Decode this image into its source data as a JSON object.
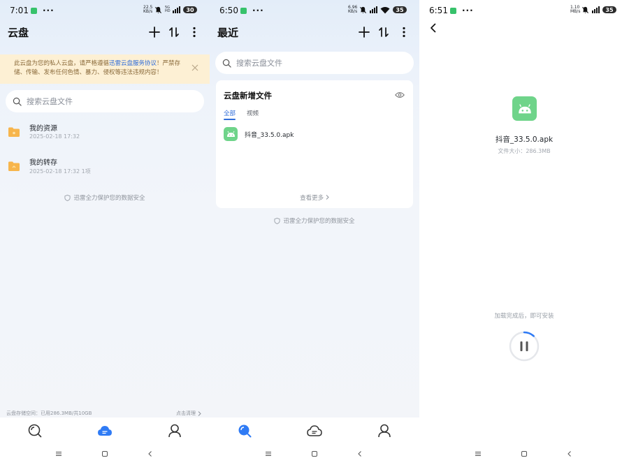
{
  "panel1": {
    "status": {
      "time": "7:01",
      "dots": "···",
      "speed": "22.5 KB/s",
      "network": "5G HD",
      "battery": "30"
    },
    "header": {
      "title": "云盘"
    },
    "notice": {
      "text_before": "此云盘为您的私人云盘，请严格遵循",
      "link": "迅雷云盘服务协议",
      "text_after": "！严禁存储、传输、发布任何色情、暴力、侵权等违法违规内容！"
    },
    "search": {
      "placeholder": "搜索云盘文件"
    },
    "folders": [
      {
        "name": "我的资源",
        "meta": "2025-02-18 17:32"
      },
      {
        "name": "我的转存",
        "meta": "2025-02-18 17:32 1项"
      }
    ],
    "safe_text": "迅雷全力保护您的数据安全",
    "storage": {
      "used": "云盘存储空间：已用286.3MB/共10GB",
      "clean": "点击清理"
    }
  },
  "panel2": {
    "status": {
      "time": "6:50",
      "dots": "···",
      "speed": "6.96 KB/s",
      "battery": "35"
    },
    "header": {
      "title": "最近"
    },
    "search": {
      "placeholder": "搜索云盘文件"
    },
    "card": {
      "title": "云盘新增文件",
      "tabs": [
        "全部",
        "视频"
      ],
      "file": "抖音_33.5.0.apk",
      "more": "查看更多"
    },
    "safe_text": "迅雷全力保护您的数据安全"
  },
  "panel3": {
    "status": {
      "time": "6:51",
      "dots": "···",
      "speed": "1.10 MB/s",
      "battery": "35"
    },
    "file_name": "抖音_33.5.0.apk",
    "file_size": "文件大小：286.3MB",
    "hint": "加载完成后，即可安装",
    "progress": 0.12
  },
  "colors": {
    "accent": "#2f6cd9",
    "folder": "#f7b54c",
    "apk": "#6fd48a",
    "notice_bg": "#fdf0d4"
  }
}
